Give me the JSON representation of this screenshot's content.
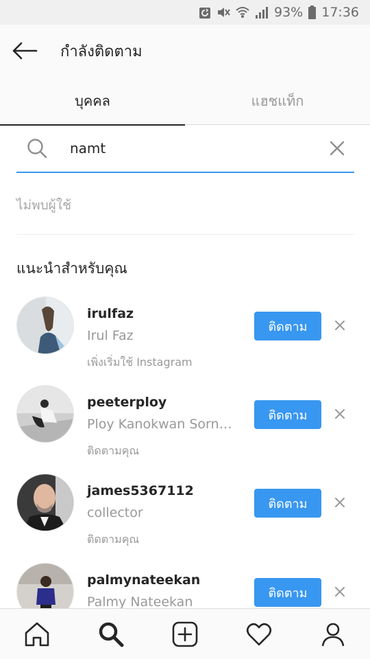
{
  "status_bar": {
    "battery_percent": "93%",
    "time": "17:36",
    "icons": [
      "sync-icon",
      "mute-icon",
      "wifi-icon",
      "signal-icon",
      "battery-icon"
    ]
  },
  "header": {
    "title": "กำลังติดตาม",
    "back_icon": "back-arrow-icon"
  },
  "tabs": [
    {
      "label": "บุคคล",
      "active": true
    },
    {
      "label": "แฮชแท็ก",
      "active": false
    }
  ],
  "search": {
    "value": "namt",
    "icon": "search-icon",
    "clear_icon": "close-icon"
  },
  "no_result_text": "ไม่พบผู้ใช้",
  "suggestions_title": "แนะนำสำหรับคุณ",
  "suggestions": [
    {
      "username": "irulfaz",
      "full_name": "Irul Faz",
      "meta": "เพิ่งเริ่มใช้ Instagram",
      "button": "ติดตาม"
    },
    {
      "username": "peeterploy",
      "full_name": "Ploy Kanokwan Sornsakul",
      "meta": "ติดตามคุณ",
      "button": "ติดตาม"
    },
    {
      "username": "james5367112",
      "full_name": "collector",
      "meta": "ติดตามคุณ",
      "button": "ติดตาม"
    },
    {
      "username": "palmynateekan",
      "full_name": "Palmy Nateekan",
      "meta": "",
      "button": "ติดตาม"
    }
  ],
  "bottom_nav": [
    "home-icon",
    "search-icon",
    "add-post-icon",
    "activity-heart-icon",
    "profile-icon"
  ],
  "colors": {
    "accent": "#3897f0",
    "text_primary": "#262626",
    "text_secondary": "#999999"
  }
}
